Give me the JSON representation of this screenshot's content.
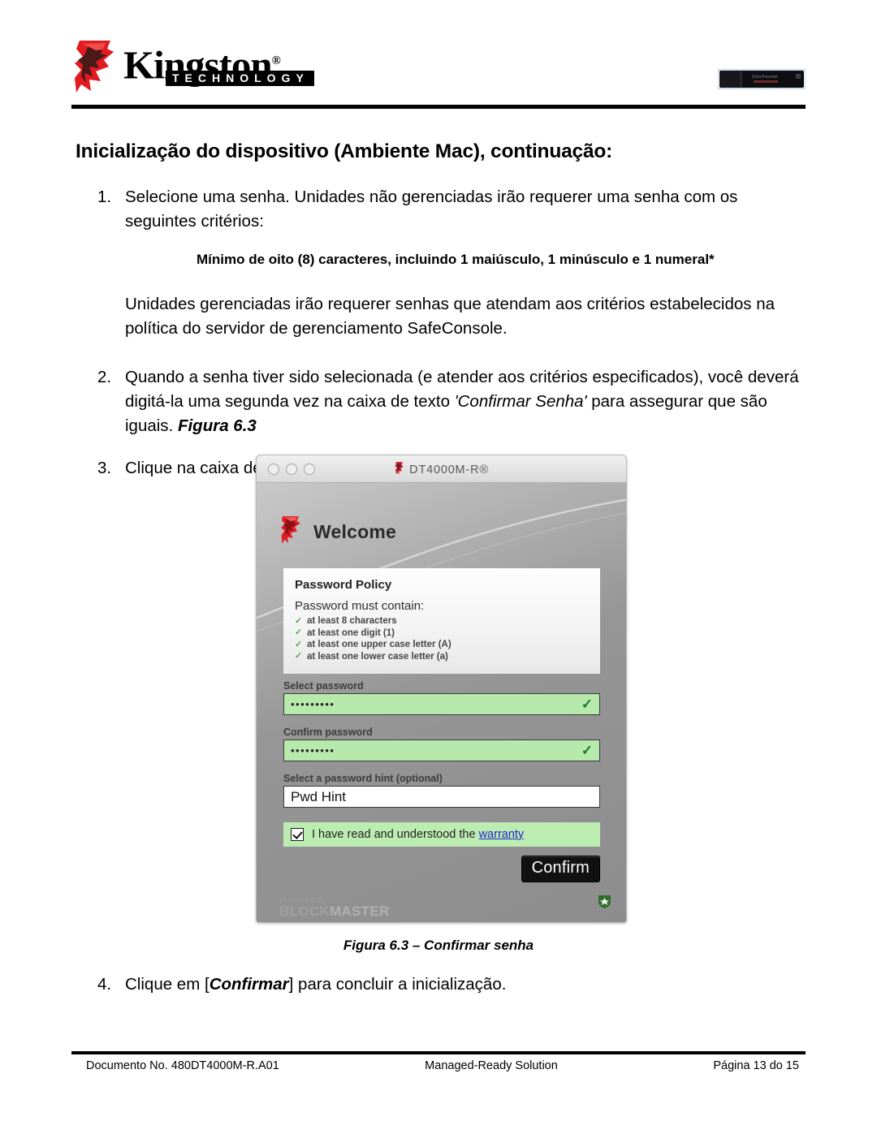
{
  "header": {
    "brand_word": "Kingston",
    "brand_reg": "®",
    "brand_tagline": "TECHNOLOGY",
    "logo_icon": "kingston-king-head-icon",
    "product_image": "usb-flash-drive-image",
    "brand_red": "#e21b22"
  },
  "page_title": "Inicialização do dispositivo (Ambiente Mac), continuação:",
  "list": {
    "item1": {
      "num": "1.",
      "text": "Selecione uma senha. Unidades não gerenciadas irão requerer uma senha com os seguintes critérios:"
    },
    "requirement_note": "Mínimo de oito (8) caracteres, incluindo 1 maiúsculo, 1 minúsculo e 1 numeral*",
    "managed_note": "Unidades gerenciadas irão requerer senhas que atendam aos critérios estabelecidos na política do servidor de gerenciamento SafeConsole.",
    "item2": {
      "num": "2.",
      "part1": "Quando a senha tiver sido selecionada (e atender aos critérios especificados), você deverá digitá-la uma segunda vez na caixa de texto ",
      "italic1": "'Confirmar Senha'",
      "part2": " para assegurar que são iguais. ",
      "bold_italic": "Figura 6.3"
    },
    "item3": {
      "num": "3.",
      "text": "Clique na caixa de seleção para aceitar a declaração de garantia."
    },
    "item4": {
      "num": "4.",
      "part1": "Clique em [",
      "bold_italic": "Confirmar",
      "part2": "] para concluir a inicialização."
    }
  },
  "figure": {
    "caption": "Figura 6.3 – Confirmar senha",
    "window": {
      "title": "DT4000M-R®",
      "title_icon": "kingston-king-head-icon",
      "traffic_lights": [
        "close-button",
        "minimize-button",
        "zoom-button"
      ],
      "welcome_heading": "Welcome",
      "welcome_icon": "kingston-king-head-icon",
      "policy": {
        "title": "Password Policy",
        "subtitle": "Password must contain:",
        "rules": [
          "at least 8 characters",
          "at least one digit (1)",
          "at least one upper case letter (A)",
          "at least one lower case letter (a)"
        ],
        "rule_marker": "check-icon"
      },
      "fields": {
        "select_password": {
          "label": "Select password",
          "value": "•••••••••",
          "valid_icon": "check-icon",
          "valid_color": "#b6e9ab"
        },
        "confirm_password": {
          "label": "Confirm password",
          "value": "•••••••••",
          "valid_icon": "check-icon",
          "valid_color": "#b6e9ab"
        },
        "password_hint": {
          "label": "Select a password hint (optional)",
          "value": "Pwd Hint",
          "placeholder": "Pwd Hint"
        }
      },
      "warranty": {
        "checked": true,
        "text_before": "I have read and understood the ",
        "link_text": "warranty",
        "link_color": "#2222cc"
      },
      "confirm_button": "Confirm",
      "footer": {
        "powered_by": "Powered by",
        "brand_dark": "BLOCK",
        "brand_light": "MASTER",
        "badge_icon": "green-shield-icon",
        "badge_color": "#2f6d2f"
      }
    }
  },
  "footer": {
    "document_no": "Documento No. 480DT4000M-R.A01",
    "solution": "Managed-Ready Solution",
    "page_no": "Página 13 do 15"
  }
}
